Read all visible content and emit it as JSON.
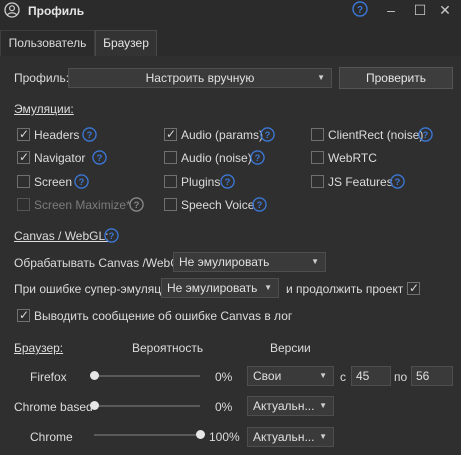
{
  "window": {
    "title": "Профиль"
  },
  "tabs": [
    {
      "label": "Пользователь",
      "active": false
    },
    {
      "label": "Браузер",
      "active": true
    }
  ],
  "profile": {
    "label": "Профиль:",
    "select_value": "Настроить вручную",
    "check_button": "Проверить"
  },
  "emulations": {
    "heading": "Эмуляции:",
    "items": [
      {
        "label": "Headers",
        "checked": true,
        "enabled": true
      },
      {
        "label": "Navigator",
        "checked": true,
        "enabled": true
      },
      {
        "label": "Screen",
        "checked": false,
        "enabled": true
      },
      {
        "label": "Screen Maximize*",
        "checked": false,
        "enabled": false
      },
      {
        "label": "Audio (params)",
        "checked": true,
        "enabled": true
      },
      {
        "label": "Audio (noise)",
        "checked": false,
        "enabled": true
      },
      {
        "label": "Plugins",
        "checked": false,
        "enabled": true
      },
      {
        "label": "Speech Voice",
        "checked": false,
        "enabled": true
      },
      {
        "label": "ClientRect (noise)",
        "checked": false,
        "enabled": true
      },
      {
        "label": "WebRTC",
        "checked": false,
        "enabled": true
      },
      {
        "label": "JS Features",
        "checked": false,
        "enabled": true
      }
    ]
  },
  "canvas": {
    "heading": "Canvas / WebGL:",
    "process_label": "Обрабатывать Canvas /WebGL",
    "process_value": "Не эмулировать",
    "error_label": "При ошибке супер-эмуляции",
    "error_value": "Не эмулировать",
    "continue_label": "и продолжить проект",
    "continue_checked": true,
    "show_error_label": "Выводить сообщение об ошибке Canvas в лог",
    "show_error_checked": true
  },
  "browsers": {
    "heading": "Браузер:",
    "col_probability": "Вероятность",
    "col_versions": "Версии",
    "rows": [
      {
        "name": "Firefox",
        "probability": "0%",
        "probability_value": 0,
        "version_mode": "Свои",
        "from_label": "с",
        "from": "45",
        "to_label": "по",
        "to": "56"
      },
      {
        "name": "Chrome based",
        "probability": "0%",
        "probability_value": 0,
        "version_mode": "Актуальн..."
      },
      {
        "name": "Chrome",
        "probability": "100%",
        "probability_value": 100,
        "version_mode": "Актуальн..."
      }
    ]
  },
  "colors": {
    "accent_icon": "#3c78d8",
    "background": "#2f2f2f"
  }
}
